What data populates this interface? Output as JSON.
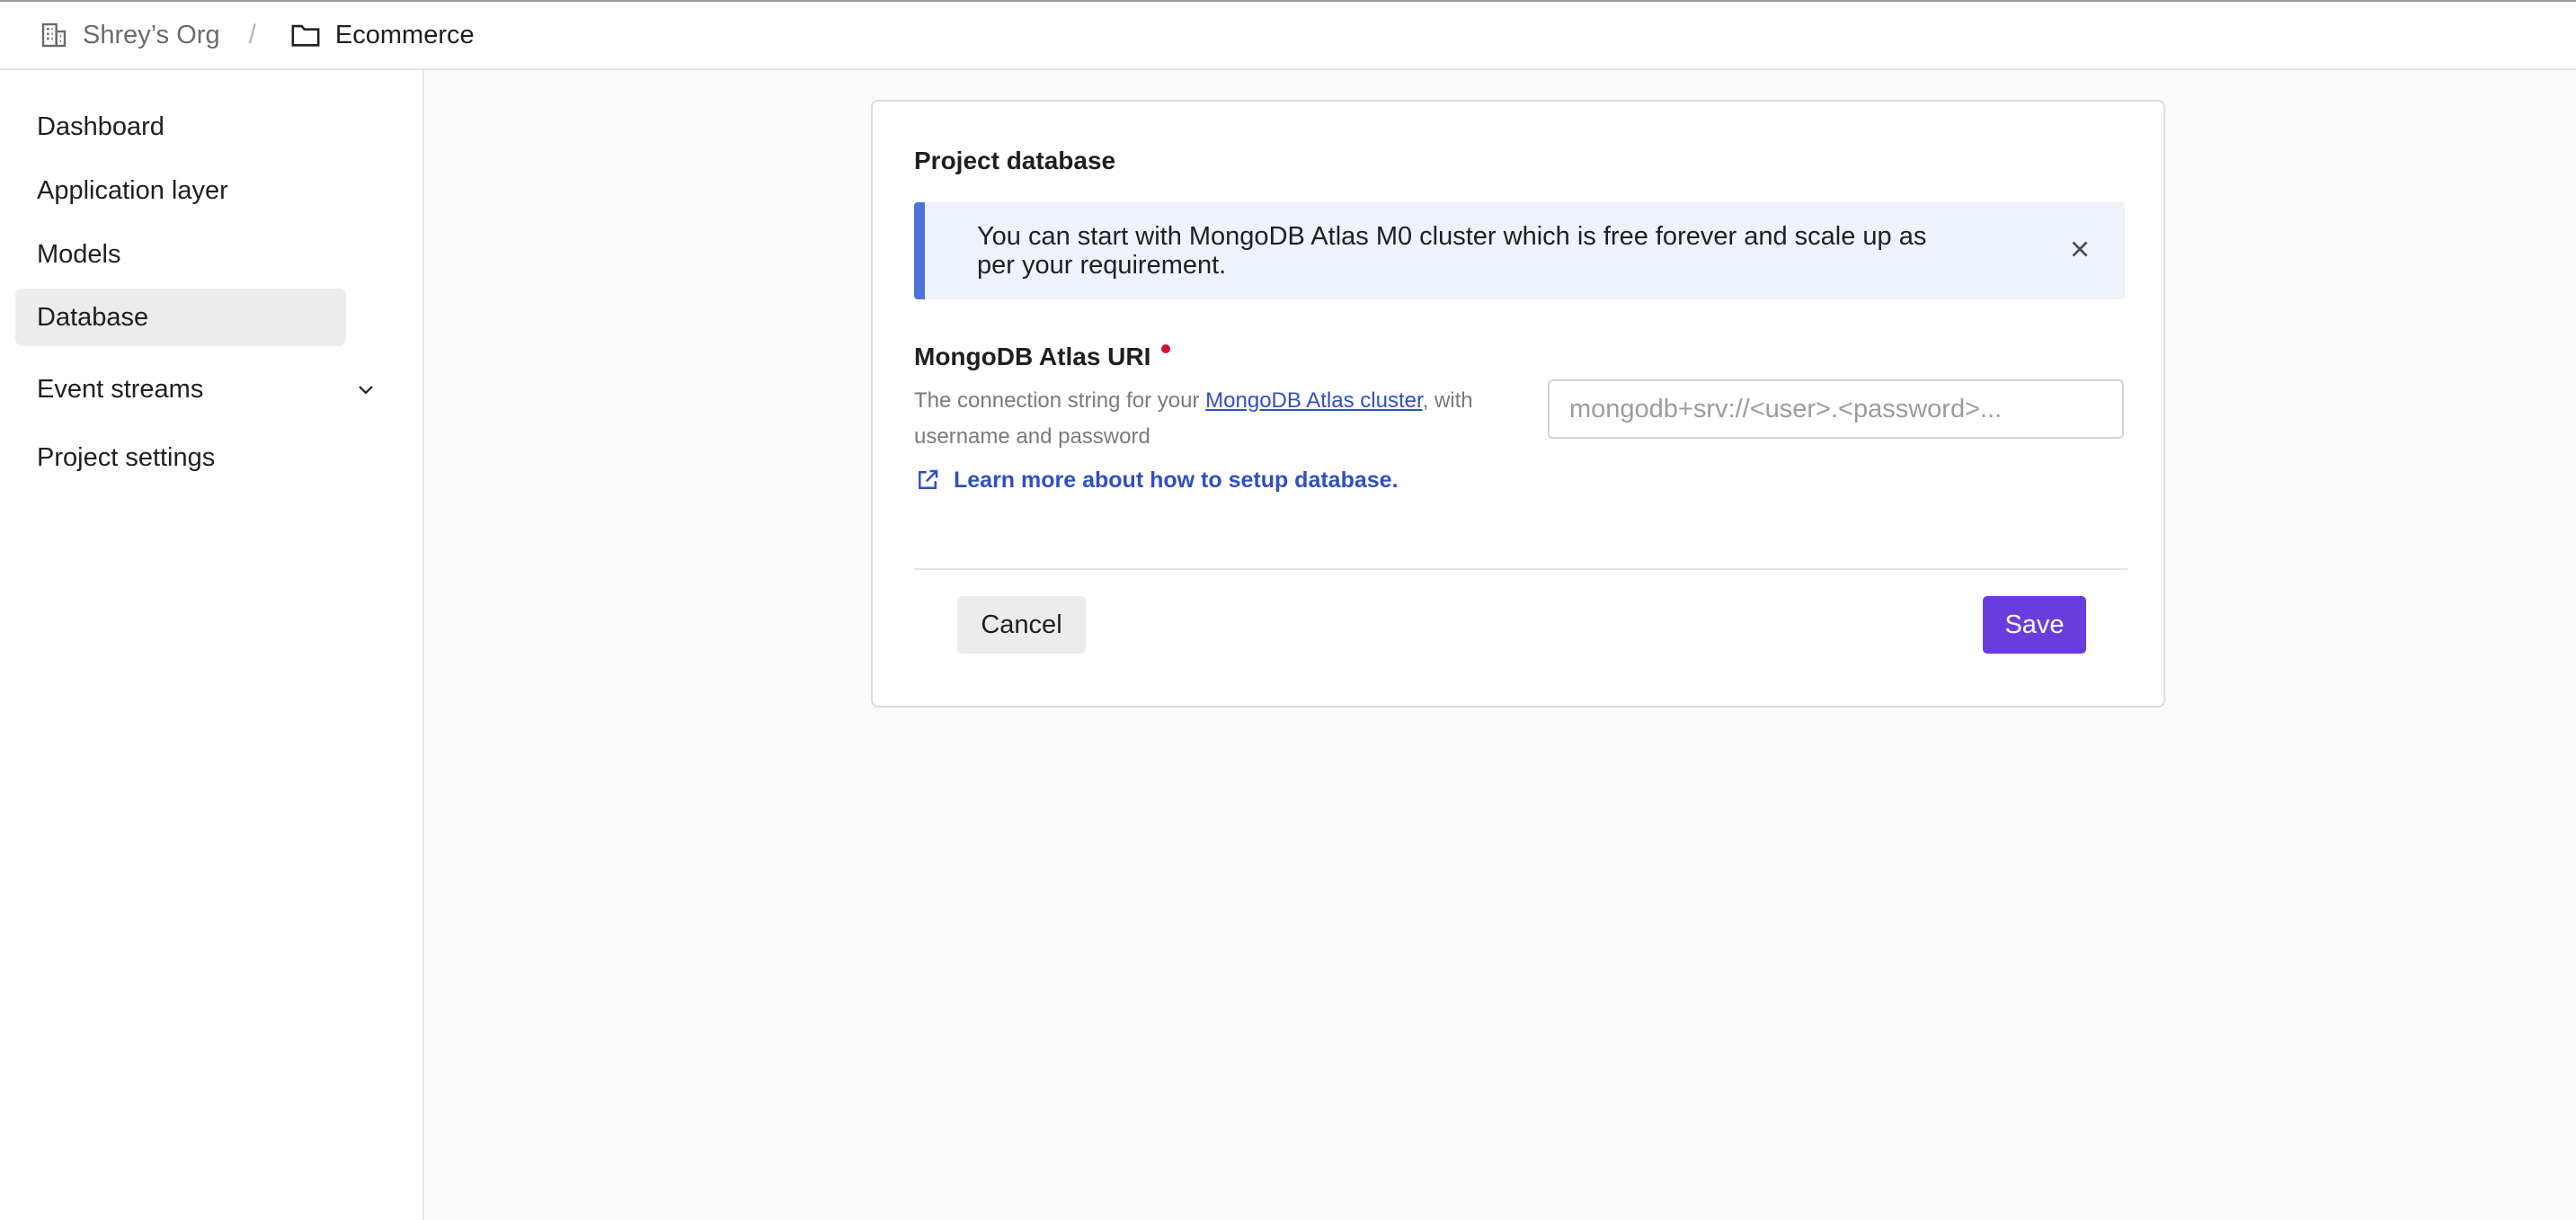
{
  "breadcrumb": {
    "org": {
      "label": "Shrey’s Org",
      "icon": "building-icon"
    },
    "separator": "/",
    "project": {
      "label": "Ecommerce",
      "icon": "folder-icon"
    }
  },
  "sidebar": {
    "items": [
      {
        "label": "Dashboard",
        "active": false
      },
      {
        "label": "Application layer",
        "active": false
      },
      {
        "label": "Models",
        "active": false
      },
      {
        "label": "Database",
        "active": true
      },
      {
        "label": "Event streams",
        "active": false,
        "expandable": true,
        "icon": "chevron-down-icon"
      },
      {
        "label": "Project settings",
        "active": false
      }
    ]
  },
  "card": {
    "title": "Project database",
    "alert": {
      "text": "You can start with MongoDB Atlas M0 cluster which is free forever and scale up as per your requirement.",
      "close_icon": "close-icon"
    },
    "field": {
      "label": "MongoDB Atlas URI",
      "required": true,
      "description_prefix": "The connection string for your ",
      "description_link": "MongoDB Atlas cluster",
      "description_suffix": ", with username and password",
      "placeholder": "mongodb+srv://<user>.<password>...",
      "value": ""
    },
    "learn_more": {
      "label": "Learn more about how to setup database.",
      "icon": "external-link-icon"
    },
    "buttons": {
      "cancel": "Cancel",
      "save": "Save"
    }
  },
  "colors": {
    "accent": "#6a3ce0",
    "link": "#2f4fc4",
    "alert_bar": "#4e72d8",
    "alert_bg": "#eef3fb",
    "required": "#d6112f"
  }
}
